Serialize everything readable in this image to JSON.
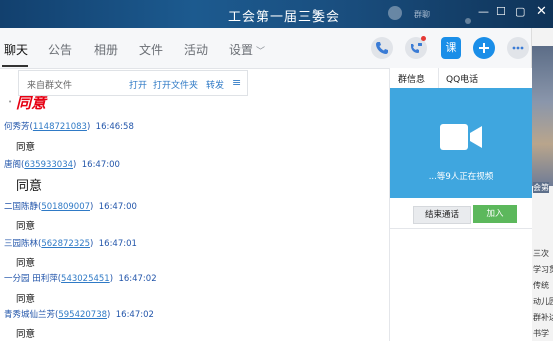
{
  "window": {
    "title": "工会第一届三委会"
  },
  "background_text": {
    "title_overlap": "群聊",
    "right_lines": [
      "会第",
      "三次",
      "学习贯",
      "传统",
      "动儿园",
      "群补达",
      "书学"
    ]
  },
  "tabs": [
    {
      "label": "聊天",
      "active": true
    },
    {
      "label": "公告"
    },
    {
      "label": "相册"
    },
    {
      "label": "文件"
    },
    {
      "label": "活动"
    },
    {
      "label": "设置"
    }
  ],
  "toolbar": {
    "icons": [
      "phone-icon",
      "video-call-icon",
      "classroom-icon",
      "add-app-icon",
      "more-icon"
    ],
    "classroom_label": "课"
  },
  "filebar": {
    "name": "来自群文件",
    "open": "打开",
    "open_folder": "打开文件夹",
    "forward": "转发"
  },
  "messages": [
    {
      "type": "big",
      "text": "同意",
      "color": "#e60012"
    },
    {
      "name": "何秀芳",
      "qq": "1148721083",
      "time": "16:46:58",
      "text": "同意"
    },
    {
      "name": "唐阁",
      "qq": "635933034",
      "time": "16:47:00",
      "text": "同意",
      "big": true
    },
    {
      "name": "二国陈静",
      "qq": "501809007",
      "time": "16:47:00",
      "text": "同意"
    },
    {
      "name": "三园陈林",
      "qq": "562872325",
      "time": "16:47:01",
      "text": "同意"
    },
    {
      "name": "一分园 田利萍",
      "qq": "543025451",
      "time": "16:47:02",
      "text": "同意"
    },
    {
      "name": "青秀城仙兰芳",
      "qq": "595420738",
      "time": "16:47:02",
      "text": "同意"
    }
  ],
  "panel": {
    "tabs": [
      "群信息",
      "QQ电话"
    ],
    "video_status": "...等9人正在视频",
    "end_call": "结束通话",
    "join": "加入"
  },
  "colors": {
    "accent": "#1a8ee8",
    "video_bg": "#3fa6df",
    "join": "#5cb85c",
    "link": "#2f7ac6"
  }
}
